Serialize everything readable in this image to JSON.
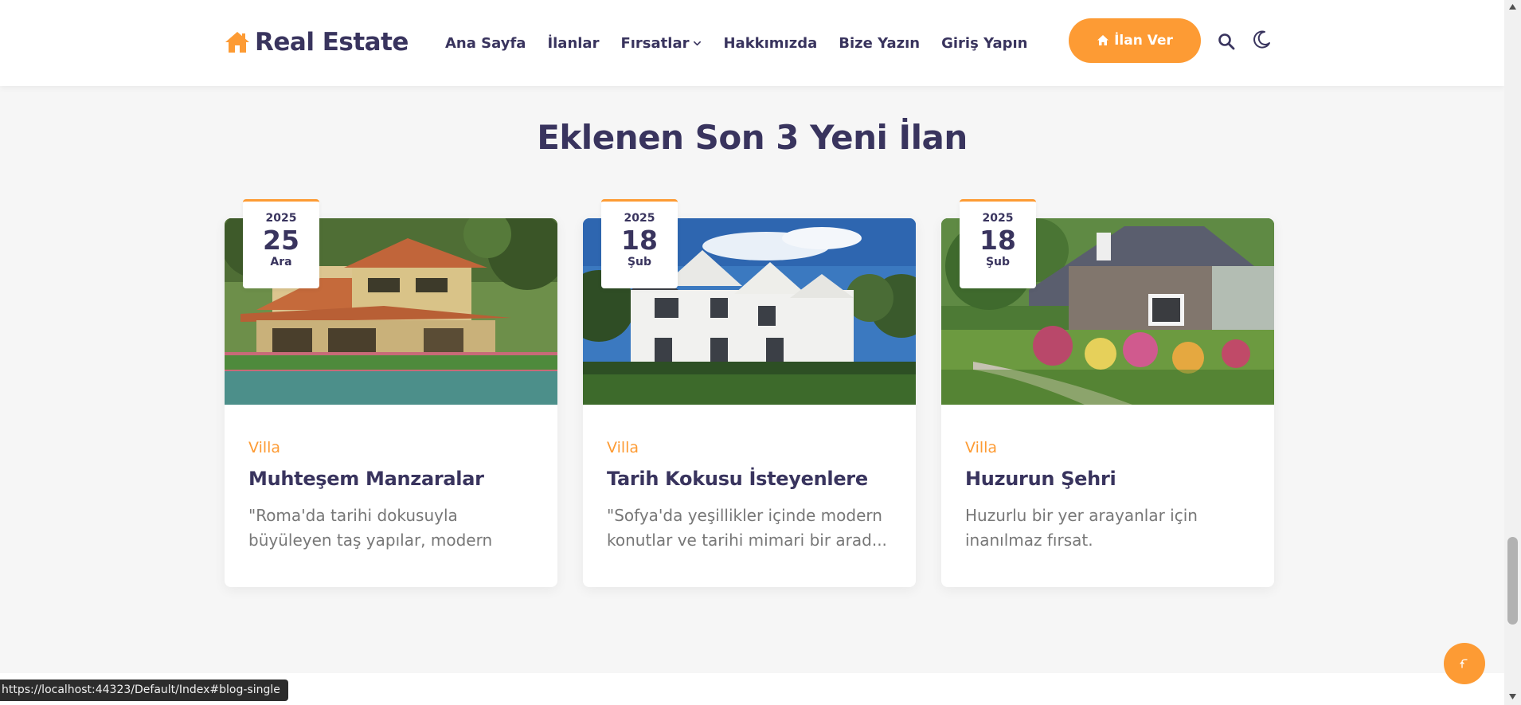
{
  "header": {
    "logo_text": "Real Estate",
    "nav": [
      {
        "label": "Ana Sayfa"
      },
      {
        "label": "İlanlar"
      },
      {
        "label": "Fırsatlar"
      },
      {
        "label": "Hakkımızda"
      },
      {
        "label": "Bize Yazın"
      },
      {
        "label": "Giriş Yapın"
      }
    ],
    "cta_label": "İlan Ver"
  },
  "section": {
    "title": "Eklenen Son 3 Yeni İlan"
  },
  "listings": [
    {
      "year": "2025",
      "day": "25",
      "month": "Ara",
      "category": "Villa",
      "title": "Muhteşem Manzaralar",
      "description": "\"Roma'da tarihi dokusuyla büyüleyen taş yapılar, modern konforla buluş..."
    },
    {
      "year": "2025",
      "day": "18",
      "month": "Şub",
      "category": "Villa",
      "title": "Tarih Kokusu İsteyenlere",
      "description": "\"Sofya'da yeşillikler içinde modern konutlar ve tarihi mimari bir arad..."
    },
    {
      "year": "2025",
      "day": "18",
      "month": "Şub",
      "category": "Villa",
      "title": "Huzurun Şehri",
      "description": "Huzurlu bir yer arayanlar için inanılmaz fırsat."
    }
  ],
  "status_url": "https://localhost:44323/Default/Index#blog-single",
  "colors": {
    "accent": "#fd9b34",
    "heading": "#39345e",
    "muted": "#777777",
    "background": "#f6f6f6"
  },
  "icons": {
    "logo": "house-icon",
    "cta": "house-icon",
    "search": "search-icon",
    "theme": "moon-icon",
    "dropdown": "chevron-down-icon",
    "back_to_top": "arrow-up-icon"
  }
}
